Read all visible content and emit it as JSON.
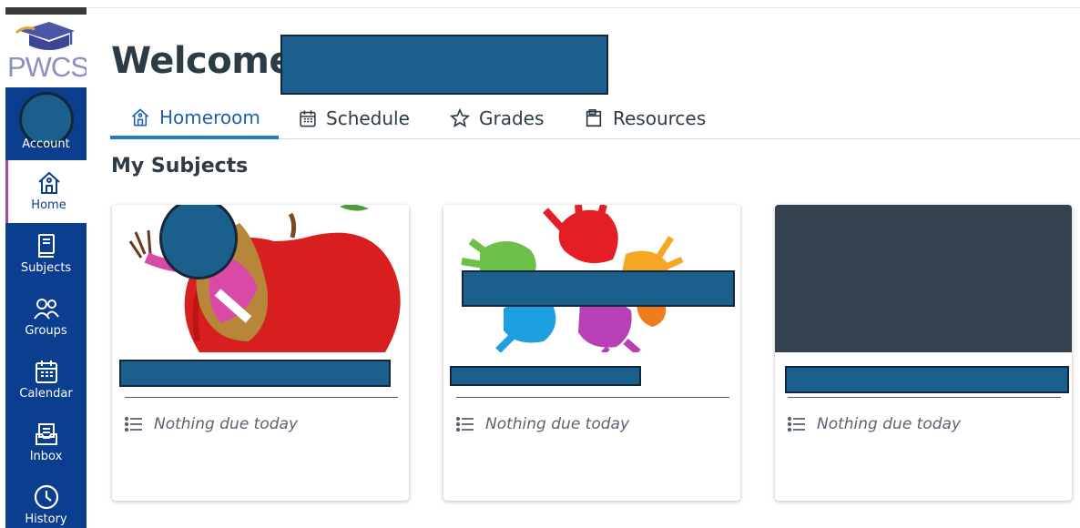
{
  "nav": {
    "logo_text": "PWCS",
    "account_label": "Account",
    "items": [
      {
        "label": "Home",
        "icon": "home-icon",
        "active": true
      },
      {
        "label": "Subjects",
        "icon": "book-icon",
        "active": false
      },
      {
        "label": "Groups",
        "icon": "groups-icon",
        "active": false
      },
      {
        "label": "Calendar",
        "icon": "calendar-icon",
        "active": false
      },
      {
        "label": "Inbox",
        "icon": "inbox-icon",
        "active": false
      },
      {
        "label": "History",
        "icon": "clock-icon",
        "active": false
      }
    ]
  },
  "header": {
    "welcome": "Welcome,",
    "tabs": [
      {
        "label": "Homeroom",
        "icon": "home-icon",
        "active": true
      },
      {
        "label": "Schedule",
        "icon": "calendar-icon",
        "active": false
      },
      {
        "label": "Grades",
        "icon": "star-icon",
        "active": false
      },
      {
        "label": "Resources",
        "icon": "clipboard-icon",
        "active": false
      }
    ]
  },
  "main": {
    "section_title": "My Subjects",
    "cards": [
      {
        "status": "Nothing due today",
        "banner": "apple-illustration"
      },
      {
        "status": "Nothing due today",
        "banner": "handprints-illustration"
      },
      {
        "status": "Nothing due today",
        "banner": "solid-dark"
      }
    ]
  },
  "colors": {
    "nav_bg": "#0b3e8e",
    "accent": "#1f78c8",
    "redaction": "#1b5f8c",
    "text": "#2d3b45",
    "card_dark_banner": "#34414f"
  }
}
